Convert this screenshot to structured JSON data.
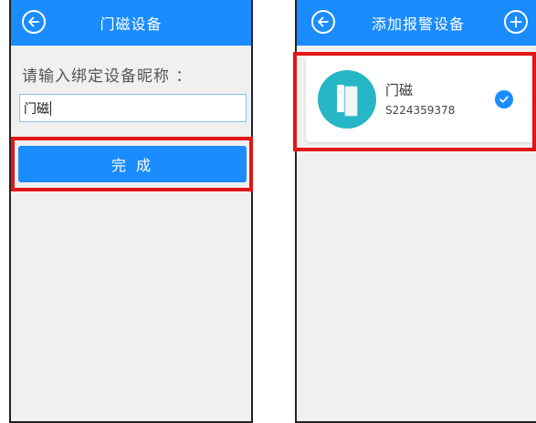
{
  "left_screen": {
    "title": "门磁设备",
    "prompt": "请输入绑定设备昵称 ：",
    "nickname_value": "门磁",
    "done_label": "完 成"
  },
  "right_screen": {
    "title": "添加报警设备",
    "device": {
      "name": "门磁",
      "serial": "S224359378",
      "selected": true
    }
  },
  "icons": {
    "back": "back-arrow-icon",
    "add": "plus-icon",
    "check": "check-icon",
    "device": "door-sensor-icon"
  },
  "colors": {
    "accent": "#1a8cff",
    "highlight": "#e31515",
    "device_avatar": "#27b6c6",
    "screen_bg": "#f0f0f0"
  }
}
